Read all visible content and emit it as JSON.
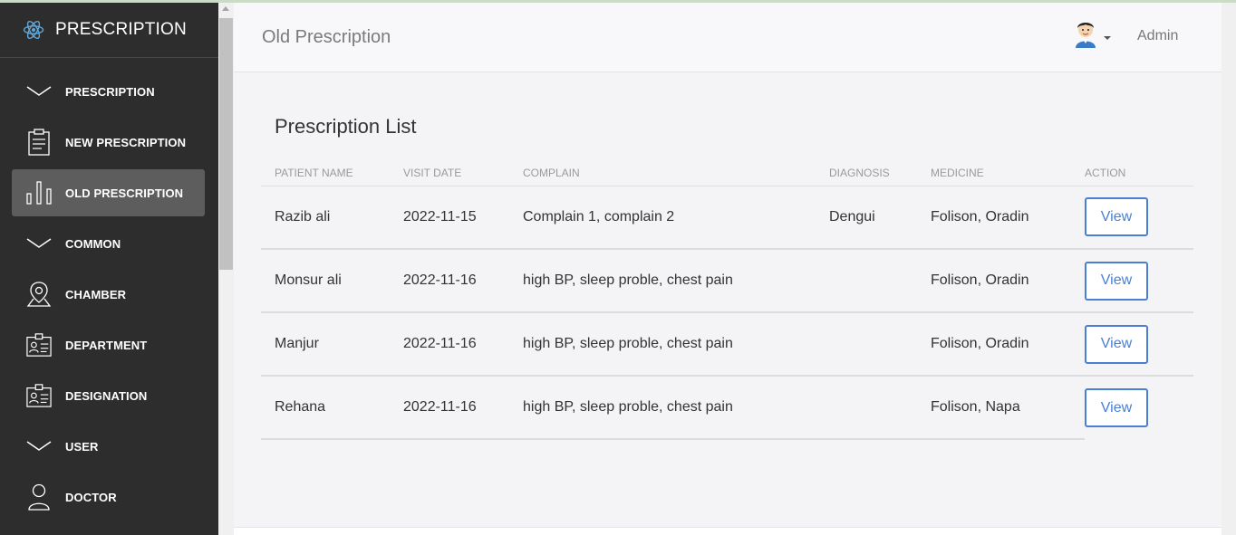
{
  "brand": {
    "title": "PRESCRIPTION",
    "icon": "react-atom-icon"
  },
  "sidebar": {
    "items": [
      {
        "label": "PRESCRIPTION",
        "icon": "chevron-down-icon",
        "active": false
      },
      {
        "label": "NEW PRESCRIPTION",
        "icon": "clipboard-icon",
        "active": false
      },
      {
        "label": "OLD PRESCRIPTION",
        "icon": "bar-chart-icon",
        "active": true
      },
      {
        "label": "COMMON",
        "icon": "chevron-down-icon",
        "active": false
      },
      {
        "label": "CHAMBER",
        "icon": "map-pin-icon",
        "active": false
      },
      {
        "label": "DEPARTMENT",
        "icon": "id-card-icon",
        "active": false
      },
      {
        "label": "DESIGNATION",
        "icon": "id-card-icon",
        "active": false
      },
      {
        "label": "USER",
        "icon": "chevron-down-icon",
        "active": false
      },
      {
        "label": "DOCTOR",
        "icon": "user-icon",
        "active": false
      }
    ]
  },
  "header": {
    "title": "Old Prescription",
    "user": "Admin"
  },
  "main": {
    "title": "Prescription List",
    "columns": [
      "PATIENT NAME",
      "VISIT DATE",
      "COMPLAIN",
      "DIAGNOSIS",
      "MEDICINE",
      "ACTION"
    ],
    "rows": [
      {
        "name": "Razib ali",
        "date": "2022-11-15",
        "complain": "Complain 1, complain 2",
        "diagnosis": "Dengui",
        "medicine": "Folison, Oradin",
        "action": "View"
      },
      {
        "name": "Monsur ali",
        "date": "2022-11-16",
        "complain": "high BP, sleep proble, chest pain",
        "diagnosis": "",
        "medicine": "Folison, Oradin",
        "action": "View"
      },
      {
        "name": "Manjur",
        "date": "2022-11-16",
        "complain": "high BP, sleep proble, chest pain",
        "diagnosis": "",
        "medicine": "Folison, Oradin",
        "action": "View"
      },
      {
        "name": "Rehana",
        "date": "2022-11-16",
        "complain": "high BP, sleep proble, chest pain",
        "diagnosis": "",
        "medicine": "Folison, Napa",
        "action": "View"
      }
    ]
  },
  "colors": {
    "sidebar_bg": "#2d2d2d",
    "active_item": "#5d5d5d",
    "accent": "#4a7fd4",
    "brand_icon": "#61a8d8"
  }
}
